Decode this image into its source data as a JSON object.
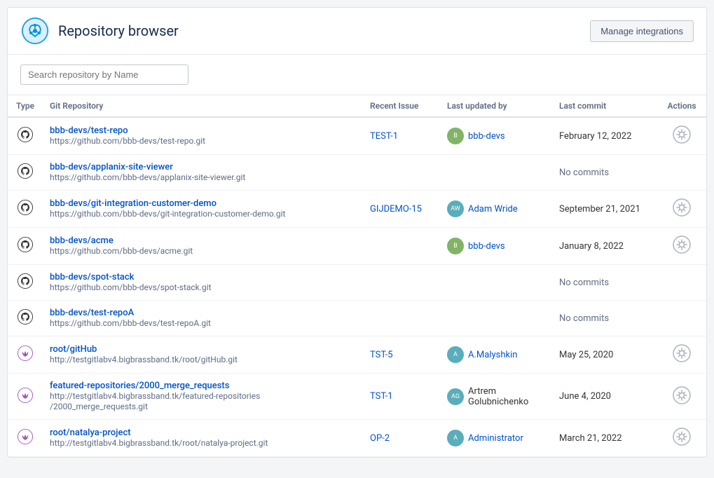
{
  "header": {
    "title": "Repository browser",
    "manage_btn": "Manage integrations"
  },
  "search": {
    "placeholder": "Search repository by Name"
  },
  "table": {
    "columns": [
      "Type",
      "Git Repository",
      "Recent Issue",
      "Last updated by",
      "Last commit",
      "Actions"
    ],
    "rows": [
      {
        "type": "github",
        "repo_name": "bbb-devs/test-repo",
        "repo_url": "https://github.com/bbb-devs/test-repo.git",
        "issue": "TEST-1",
        "updated_by": "bbb-devs",
        "updated_by_has_avatar": true,
        "commit_date": "February 12, 2022",
        "has_action": true
      },
      {
        "type": "github",
        "repo_name": "bbb-devs/applanix-site-viewer",
        "repo_url": "https://github.com/bbb-devs/applanix-site-viewer.git",
        "issue": "",
        "updated_by": "",
        "updated_by_has_avatar": false,
        "commit_date": "No commits",
        "has_action": false
      },
      {
        "type": "github",
        "repo_name": "bbb-devs/git-integration-customer-demo",
        "repo_url": "https://github.com/bbb-devs/git-integration-customer-demo.git",
        "issue": "GIJDEMO-15",
        "updated_by": "Adam Wride",
        "updated_by_has_avatar": true,
        "commit_date": "September 21, 2021",
        "has_action": true
      },
      {
        "type": "github",
        "repo_name": "bbb-devs/acme",
        "repo_url": "https://github.com/bbb-devs/acme.git",
        "issue": "",
        "updated_by": "bbb-devs",
        "updated_by_has_avatar": true,
        "commit_date": "January 8, 2022",
        "has_action": true
      },
      {
        "type": "github",
        "repo_name": "bbb-devs/spot-stack",
        "repo_url": "https://github.com/bbb-devs/spot-stack.git",
        "issue": "",
        "updated_by": "",
        "updated_by_has_avatar": false,
        "commit_date": "No commits",
        "has_action": false
      },
      {
        "type": "github",
        "repo_name": "bbb-devs/test-repoA",
        "repo_url": "https://github.com/bbb-devs/test-repoA.git",
        "issue": "",
        "updated_by": "",
        "updated_by_has_avatar": false,
        "commit_date": "No commits",
        "has_action": false
      },
      {
        "type": "gitlab",
        "repo_name": "root/gitHub",
        "repo_url": "http://testgitlabv4.bigbrassband.tk/root/gitHub.git",
        "issue": "TST-5",
        "updated_by": "A.Malyshkin",
        "updated_by_has_avatar": true,
        "commit_date": "May 25, 2020",
        "has_action": true
      },
      {
        "type": "gitlab",
        "repo_name": "featured-repositories/2000_merge_requests",
        "repo_url": "http://testgitlabv4.bigbrassband.tk/featured-repositories/2000_merge_requests.git",
        "repo_url_line2": "/2000_merge_requests.git",
        "issue": "TST-1",
        "updated_by": "Artrem Golubnichenko",
        "updated_by_line1": "Artrem",
        "updated_by_line2": "Golubnichenko",
        "updated_by_has_avatar": true,
        "commit_date": "June 4, 2020",
        "has_action": true
      },
      {
        "type": "gitlab",
        "repo_name": "root/natalya-project",
        "repo_url": "http://testgitlabv4.bigbrassband.tk/root/natalya-project.git",
        "issue": "OP-2",
        "updated_by": "Administrator",
        "updated_by_has_avatar": true,
        "commit_date": "March 21, 2022",
        "has_action": true
      }
    ]
  }
}
